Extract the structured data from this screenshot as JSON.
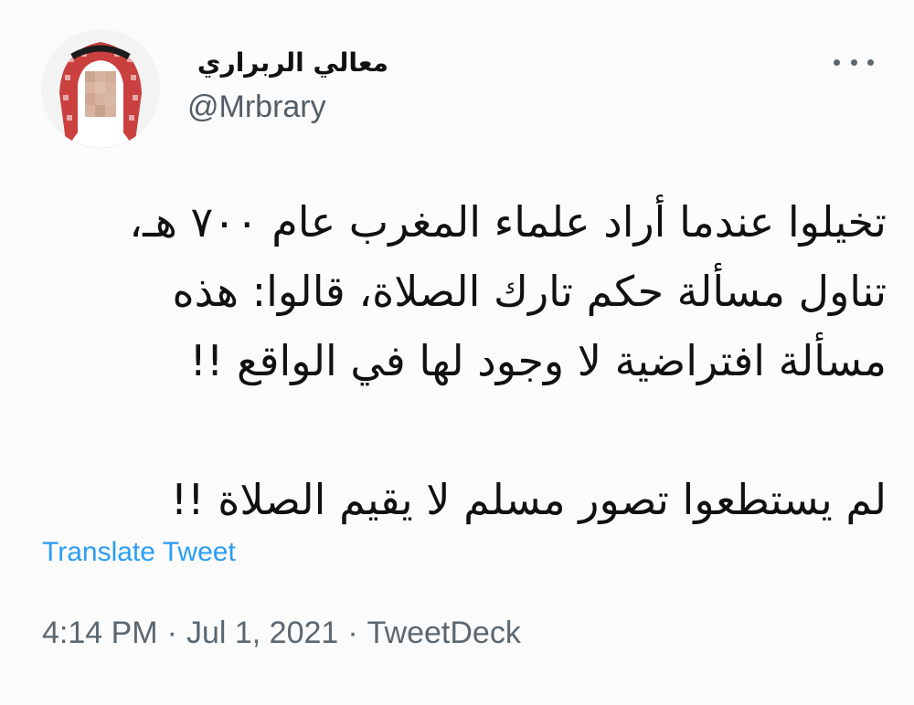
{
  "author": {
    "display_name": "معالي الربراري",
    "handle": "@Mrbrary"
  },
  "more_icon": "more-horizontal-icon",
  "tweet": {
    "lines": [
      "تخيلوا عندما أراد علماء المغرب عام ٧٠٠ هـ،",
      "تناول مسألة حكم تارك الصلاة، قالوا: هذه",
      "مسألة افتراضية لا وجود لها في الواقع !!",
      "لم يستطعوا تصور مسلم لا يقيم الصلاة !!"
    ]
  },
  "translate_label": "Translate Tweet",
  "meta": {
    "time": "4:14 PM",
    "separator": "·",
    "date": "Jul 1, 2021",
    "source": "TweetDeck"
  },
  "colors": {
    "link": "#2a9df4",
    "secondary": "#5b6770",
    "background": "#fbfbfb"
  }
}
